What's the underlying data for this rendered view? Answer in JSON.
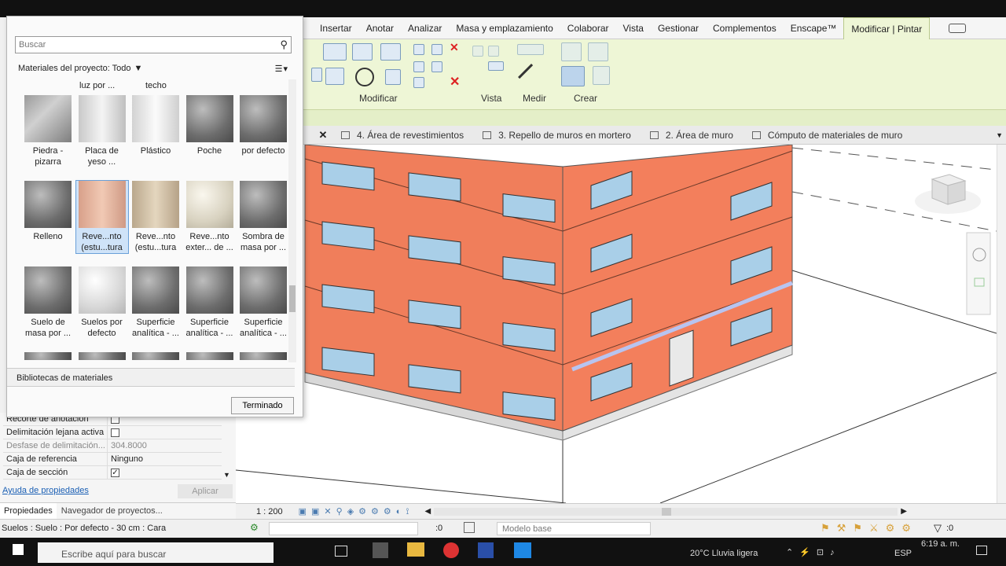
{
  "ribbon": {
    "tabs": [
      "Insertar",
      "Anotar",
      "Analizar",
      "Masa y emplazamiento",
      "Colaborar",
      "Vista",
      "Gestionar",
      "Complementos",
      "Enscape™",
      "Modificar | Pintar"
    ],
    "groups": [
      "Modificar",
      "Vista",
      "Medir",
      "Crear"
    ]
  },
  "view_tabs": [
    "4. Área de revestimientos",
    "3. Repello de muros en mortero",
    "2. Área de muro",
    "Cómputo de materiales de muro"
  ],
  "material_browser": {
    "search_placeholder": "Buscar",
    "filter_label": "Materiales del proyecto: Todo",
    "partial_top": [
      "luz por ...",
      "techo"
    ],
    "materials": [
      {
        "l1": "Piedra -",
        "l2": "pizarra",
        "kind": "stone"
      },
      {
        "l1": "Placa de",
        "l2": "yeso ...",
        "kind": "board"
      },
      {
        "l1": "Plástico",
        "l2": "",
        "kind": "cyl"
      },
      {
        "l1": "Poche",
        "l2": "",
        "kind": "sphere"
      },
      {
        "l1": "por defecto",
        "l2": "",
        "kind": "sphere"
      },
      {
        "l1": "Relleno",
        "l2": "",
        "kind": "sphere"
      },
      {
        "l1": "Reve...nto",
        "l2": "(estu...tura",
        "kind": "pink",
        "selected": true
      },
      {
        "l1": "Reve...nto",
        "l2": "(estu...tura",
        "kind": "beige"
      },
      {
        "l1": "Reve...nto",
        "l2": "exter... de ...",
        "kind": "cream"
      },
      {
        "l1": "Sombra de",
        "l2": "masa por ...",
        "kind": "sphere"
      },
      {
        "l1": "Suelo de",
        "l2": "masa por ...",
        "kind": "sphere"
      },
      {
        "l1": "Suelos por",
        "l2": "defecto",
        "kind": "white"
      },
      {
        "l1": "Superficie",
        "l2": "analítica - ...",
        "kind": "sphere"
      },
      {
        "l1": "Superficie",
        "l2": "analítica - ...",
        "kind": "sphere"
      },
      {
        "l1": "Superficie",
        "l2": "analítica - ...",
        "kind": "sphere"
      }
    ],
    "libraries_label": "Bibliotecas de materiales",
    "done_label": "Terminado"
  },
  "properties": {
    "rows": [
      {
        "label": "Recorte de anotación",
        "value": "",
        "check": false
      },
      {
        "label": "Delimitación lejana activa",
        "value": "",
        "check": false
      },
      {
        "label": "Desfase de delimitación...",
        "value": "304.8000",
        "check": null,
        "dim": true
      },
      {
        "label": "Caja de referencia",
        "value": "Ninguno",
        "check": null
      },
      {
        "label": "Caja de sección",
        "value": "",
        "check": true
      }
    ],
    "help_link": "Ayuda de propiedades",
    "apply_label": "Aplicar",
    "tab_props": "Propiedades",
    "tab_nav": "Navegador de proyectos..."
  },
  "view_status": {
    "scale": "1 : 200"
  },
  "status": {
    "message": "Suelos : Suelo : Por defecto - 30 cm : Cara",
    "counter": ":0",
    "model": "Modelo base",
    "filter_count": ":0"
  },
  "taskbar": {
    "search": "Escribe aquí para buscar",
    "weather": "20°C  Lluvia ligera",
    "lang": "ESP",
    "time": "6:19 a. m."
  },
  "colors": {
    "facade": "#f07e5b",
    "ribbon_bg": "#eef6d6",
    "accent": "#1a5fb4"
  }
}
